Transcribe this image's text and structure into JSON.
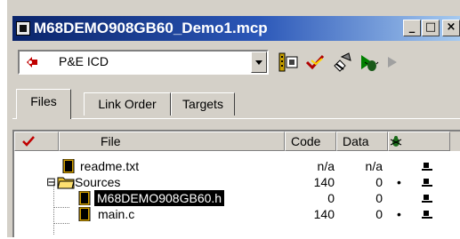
{
  "window": {
    "title": "M68DEMO908GB60_Demo1.mcp",
    "icon": "project-icon",
    "buttons": {
      "minimize": "_",
      "maximize": "□",
      "close": "×"
    }
  },
  "toolbar": {
    "target": "P&E ICD",
    "icons": [
      "settings-icon",
      "sync-icon",
      "make-icon",
      "debug-icon",
      "run-icon"
    ]
  },
  "tabs": [
    {
      "label": "Files",
      "active": true
    },
    {
      "label": "Link Order",
      "active": false
    },
    {
      "label": "Targets",
      "active": false
    }
  ],
  "columns": {
    "check_icon": "checkmark-icon",
    "file": "File",
    "code": "Code",
    "data": "Data",
    "debug_icon": "bug-icon"
  },
  "files": [
    {
      "name": "readme.txt",
      "code": "n/a",
      "data": "n/a",
      "dot": "",
      "selected": false,
      "type": "file"
    },
    {
      "name": "Sources",
      "code": "140",
      "data": "0",
      "dot": "•",
      "selected": false,
      "type": "folder"
    },
    {
      "name": "M68DEMO908GB60.h",
      "code": "0",
      "data": "0",
      "dot": "",
      "selected": true,
      "type": "file"
    },
    {
      "name": "main.c",
      "code": "140",
      "data": "0",
      "dot": "•",
      "selected": false,
      "type": "file"
    }
  ],
  "tree_toggle": "⊟"
}
